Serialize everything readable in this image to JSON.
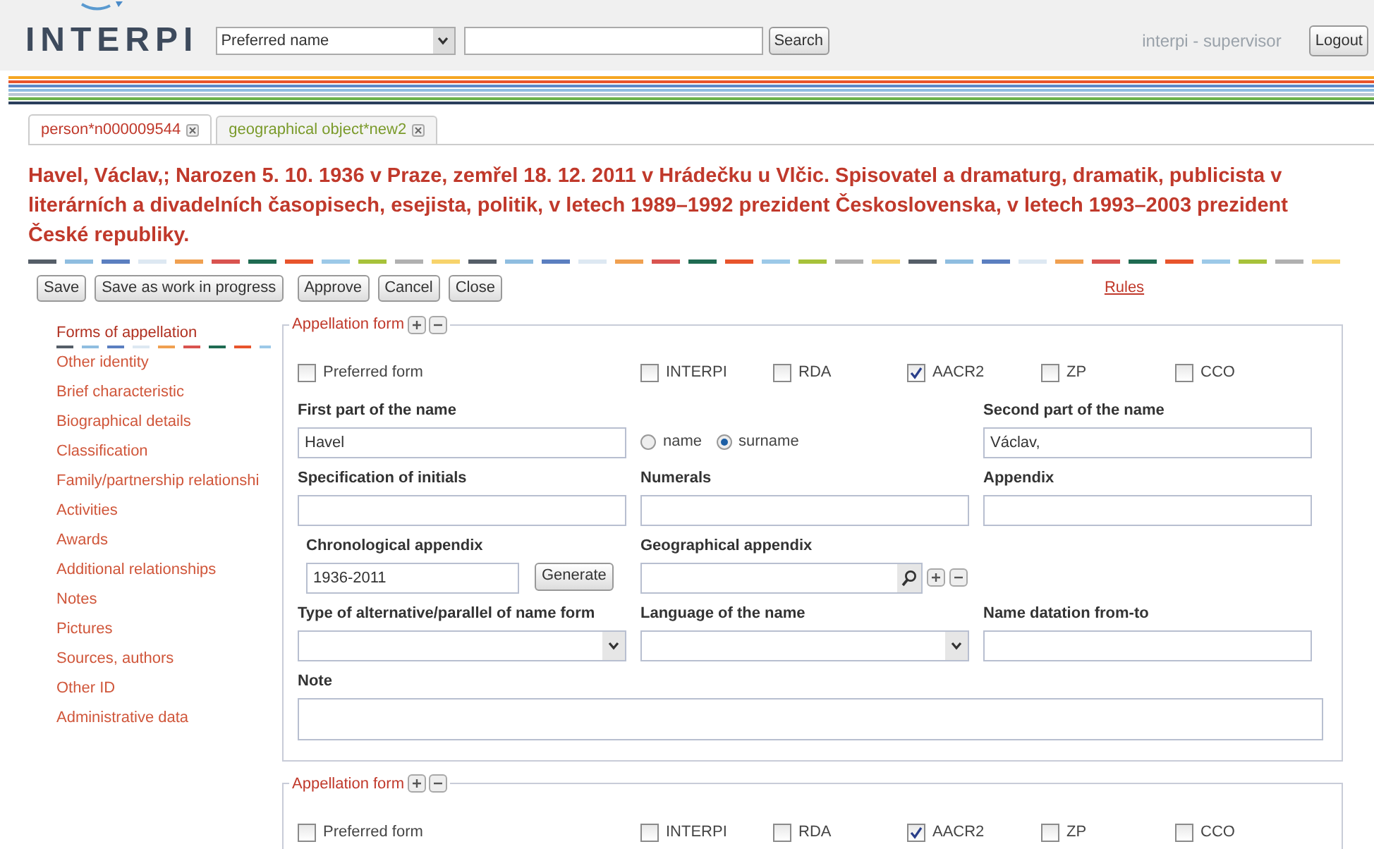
{
  "header": {
    "logo": "INTERPI",
    "search_select": "Preferred name",
    "search_button": "Search",
    "user": "interpi - supervisor",
    "logout": "Logout"
  },
  "tabs": [
    {
      "label": "person*n000009544",
      "selected": true,
      "color": "#c0392b"
    },
    {
      "label": "geographical object*new2",
      "selected": false,
      "color": "#7a9a2a"
    }
  ],
  "heading": "Havel, Václav,; Narozen 5. 10. 1936 v Praze, zemřel 18. 12. 2011 v Hrádečku u Vlčic. Spisovatel a dramaturg, dramatik, publicista v literárních a divadelních časopisech, esejista, politik, v letech 1989–1992 prezident Československa, v letech 1993–2003 prezident České republiky.",
  "toolbar": {
    "buttons": [
      "Save",
      "Save as work in progress",
      "Approve",
      "Cancel",
      "Close"
    ],
    "rules_link": "Rules"
  },
  "sidebar": {
    "items": [
      {
        "label": "Forms of appellation",
        "selected": true
      },
      {
        "label": "Other identity",
        "selected": false
      },
      {
        "label": "Brief characteristic",
        "selected": false
      },
      {
        "label": "Biographical details",
        "selected": false
      },
      {
        "label": "Classification",
        "selected": false
      },
      {
        "label": "Family/partnership relationshi",
        "selected": false
      },
      {
        "label": "Activities",
        "selected": false
      },
      {
        "label": "Awards",
        "selected": false
      },
      {
        "label": "Additional relationships",
        "selected": false
      },
      {
        "label": "Notes",
        "selected": false
      },
      {
        "label": "Pictures",
        "selected": false
      },
      {
        "label": "Sources, authors",
        "selected": false
      },
      {
        "label": "Other ID",
        "selected": false
      },
      {
        "label": "Administrative data",
        "selected": false
      }
    ]
  },
  "forms": [
    {
      "title": "Appellation form",
      "checkboxes": [
        {
          "label": "Preferred form",
          "checked": false
        },
        {
          "label": "INTERPI",
          "checked": false
        },
        {
          "label": "RDA",
          "checked": false
        },
        {
          "label": "AACR2",
          "checked": true
        },
        {
          "label": "ZP",
          "checked": false
        },
        {
          "label": "CCO",
          "checked": false
        }
      ],
      "rows": [
        [
          {
            "kind": "text",
            "label": "First part of the name",
            "value": "Havel"
          },
          {
            "kind": "radio",
            "options": [
              {
                "label": "name",
                "selected": false
              },
              {
                "label": "surname",
                "selected": true
              }
            ]
          },
          {
            "kind": "text",
            "label": "Second part of the name",
            "value": "Václav,"
          }
        ],
        [
          {
            "kind": "text",
            "label": "Specification of initials"
          },
          {
            "kind": "text",
            "label": "Numerals"
          },
          {
            "kind": "text",
            "label": "Appendix"
          }
        ],
        [
          {
            "kind": "generate",
            "label": "Chronological appendix",
            "value": "1936-2011",
            "button": "Generate"
          },
          {
            "kind": "lookup",
            "label": "Geographical appendix"
          }
        ],
        [
          {
            "kind": "select",
            "label": "Type of alternative/parallel of name form"
          },
          {
            "kind": "select",
            "label": "Language of the name"
          },
          {
            "kind": "text",
            "label": "Name datation from-to"
          }
        ],
        [
          {
            "kind": "textarea",
            "label": "Note"
          }
        ]
      ]
    },
    {
      "title": "Appellation form",
      "checkboxes": [
        {
          "label": "Preferred form",
          "checked": false
        },
        {
          "label": "INTERPI",
          "checked": false
        },
        {
          "label": "RDA",
          "checked": false
        },
        {
          "label": "AACR2",
          "checked": true
        },
        {
          "label": "ZP",
          "checked": false
        },
        {
          "label": "CCO",
          "checked": false
        }
      ]
    }
  ]
}
